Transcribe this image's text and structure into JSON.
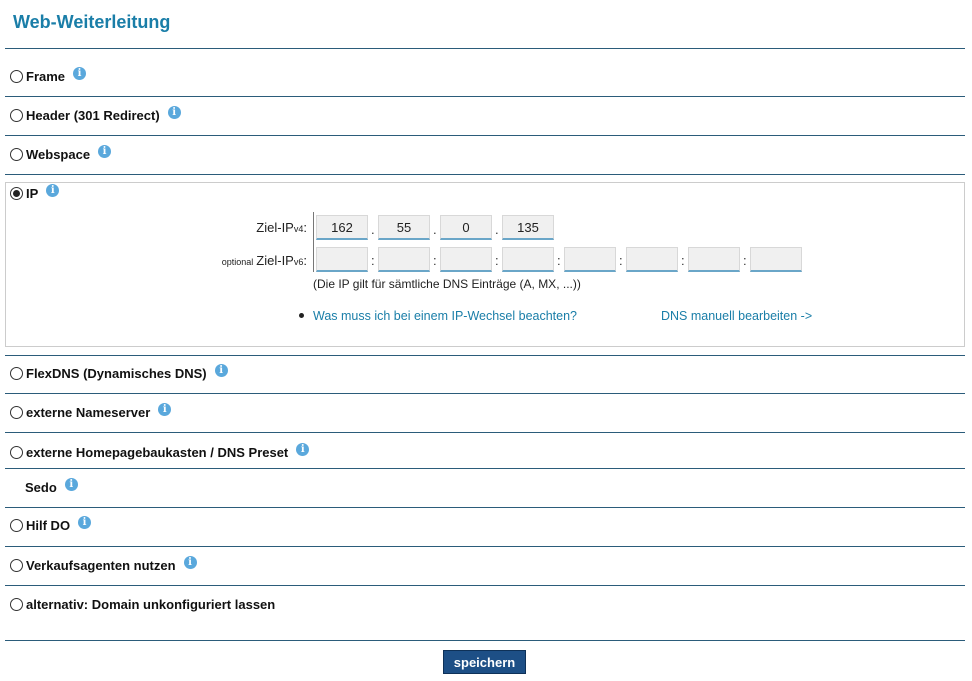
{
  "title": "Web-Weiterleitung",
  "options": {
    "frame": "Frame",
    "header": "Header (301 Redirect)",
    "webspace": "Webspace",
    "ip": "IP",
    "flexdns": "FlexDNS (Dynamisches DNS)",
    "nameserver": "externe Nameserver",
    "homepage": "externe Homepagebaukasten / DNS Preset",
    "sedo": "Sedo",
    "hilfdo": "Hilf DO",
    "agents": "Verkaufsagenten nutzen",
    "unconfigured": "alternativ: Domain unkonfiguriert lassen"
  },
  "info_glyph": "i",
  "ip": {
    "ipv4_label": "Ziel-IP",
    "ipv4_sub": "v4",
    "ipv6_optional": "optional",
    "ipv6_label": "Ziel-IP",
    "ipv6_sub": "v6",
    "colon": ":",
    "dot": ".",
    "ipv4": [
      "162",
      "55",
      "0",
      "135"
    ],
    "ipv6": [
      "",
      "",
      "",
      "",
      "",
      "",
      "",
      ""
    ],
    "note": "(Die IP gilt für sämtliche DNS Einträge (A, MX, ...))",
    "link_change": "Was muss ich bei einem IP-Wechsel beachten?",
    "link_dns": "DNS manuell bearbeiten ->"
  },
  "save_label": "speichern",
  "colors": {
    "accent": "#1a7ea8",
    "button": "#1d4f86",
    "info": "#5aa8dc"
  }
}
